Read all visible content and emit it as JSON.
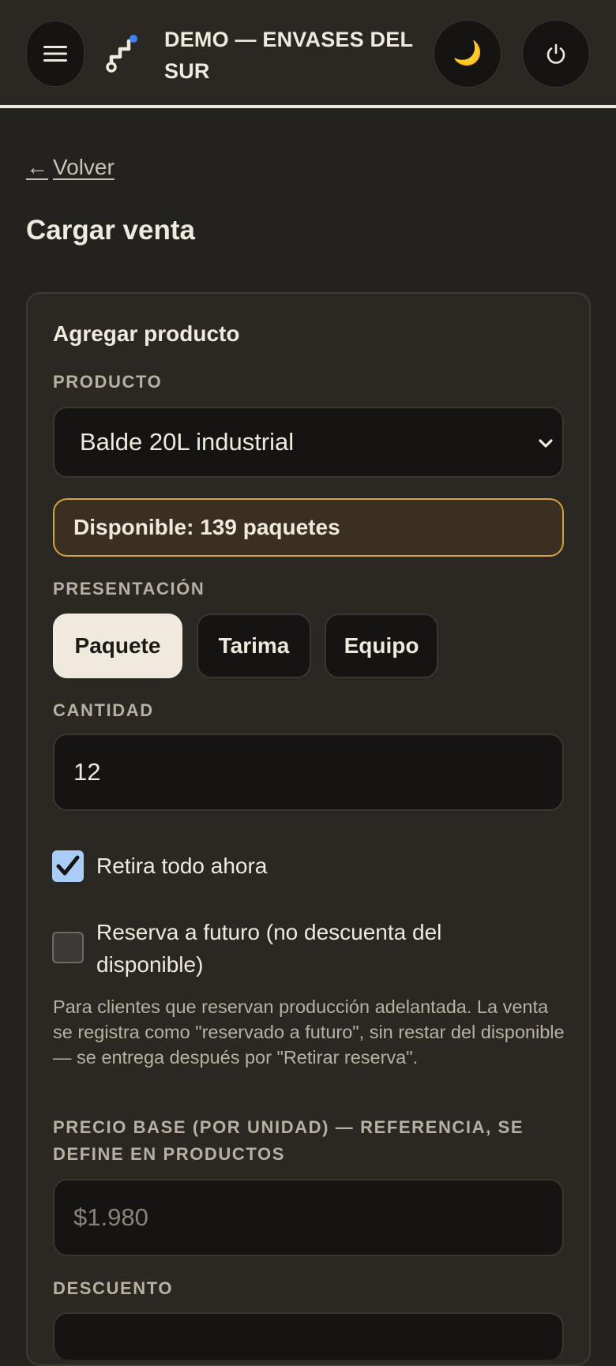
{
  "header": {
    "menu_icon": "hamburger-menu-icon",
    "logo_icon": "stairs-logo-icon",
    "title": "DEMO — ENVASES DEL SUR",
    "theme_icon": "moon-icon",
    "theme_glyph": "🌙",
    "power_icon": "power-icon"
  },
  "nav": {
    "back_arrow": "←",
    "back_label": "Volver"
  },
  "page": {
    "title": "Cargar venta"
  },
  "form": {
    "section_title": "Agregar producto",
    "product_label": "PRODUCTO",
    "product_value": "Balde 20L industrial",
    "stock_text": "Disponible: 139 paquetes",
    "presentation_label": "PRESENTACIÓN",
    "presentations": [
      {
        "label": "Paquete",
        "selected": true
      },
      {
        "label": "Tarima",
        "selected": false
      },
      {
        "label": "Equipo",
        "selected": false
      }
    ],
    "quantity_label": "CANTIDAD",
    "quantity_value": "12",
    "pickup_now_label": "Retira todo ahora",
    "pickup_now_checked": true,
    "reserve_label": "Reserva a futuro (no descuenta del disponible)",
    "reserve_checked": false,
    "reserve_help": "Para clientes que reservan producción adelantada. La venta se registra como \"reservado a futuro\", sin restar del disponible — se entrega después por \"Retirar reserva\".",
    "base_price_label": "PRECIO BASE (POR UNIDAD) — REFERENCIA, SE DEFINE EN PRODUCTOS",
    "base_price_value": "$1.980",
    "discount_label": "DESCUENTO"
  },
  "colors": {
    "background": "#24221e",
    "card": "#2b2824",
    "input": "#161412",
    "accent_warning": "#d8a13a",
    "checkbox_checked": "#a9cdf7",
    "text": "#efe9de"
  }
}
